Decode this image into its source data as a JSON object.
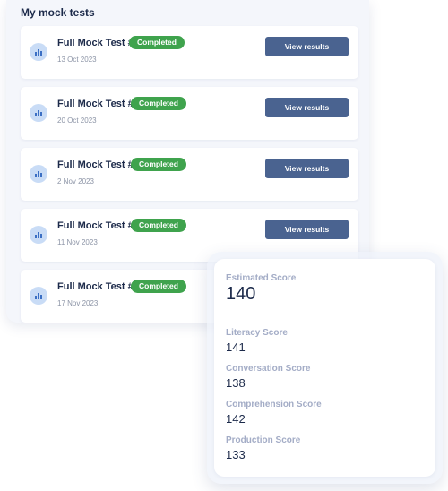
{
  "mock_tests": {
    "title": "My mock tests",
    "button_label": "View results",
    "items": [
      {
        "name": "Full Mock Test #1",
        "status": "Completed",
        "date": "13 Oct 2023"
      },
      {
        "name": "Full Mock Test #2",
        "status": "Completed",
        "date": "20 Oct 2023"
      },
      {
        "name": "Full Mock Test #3",
        "status": "Completed",
        "date": "2 Nov 2023"
      },
      {
        "name": "Full Mock Test #4",
        "status": "Completed",
        "date": "11 Nov 2023"
      },
      {
        "name": "Full Mock Test #5",
        "status": "Completed",
        "date": "17 Nov 2023"
      }
    ],
    "icon": "bar-chart-icon"
  },
  "scores": {
    "estimated": {
      "label": "Estimated Score",
      "value": "140"
    },
    "breakdown": [
      {
        "label": "Literacy Score",
        "value": "141"
      },
      {
        "label": "Conversation Score",
        "value": "138"
      },
      {
        "label": "Comprehension Score",
        "value": "142"
      },
      {
        "label": "Production Score",
        "value": "133"
      }
    ]
  },
  "colors": {
    "badge_green": "#3fa34d",
    "button_blue": "#4a6390",
    "icon_bg": "#c9dcf6",
    "icon_fg": "#3b6fc4",
    "text_dark": "#1c2a4a",
    "label_muted": "#a3acc6"
  }
}
